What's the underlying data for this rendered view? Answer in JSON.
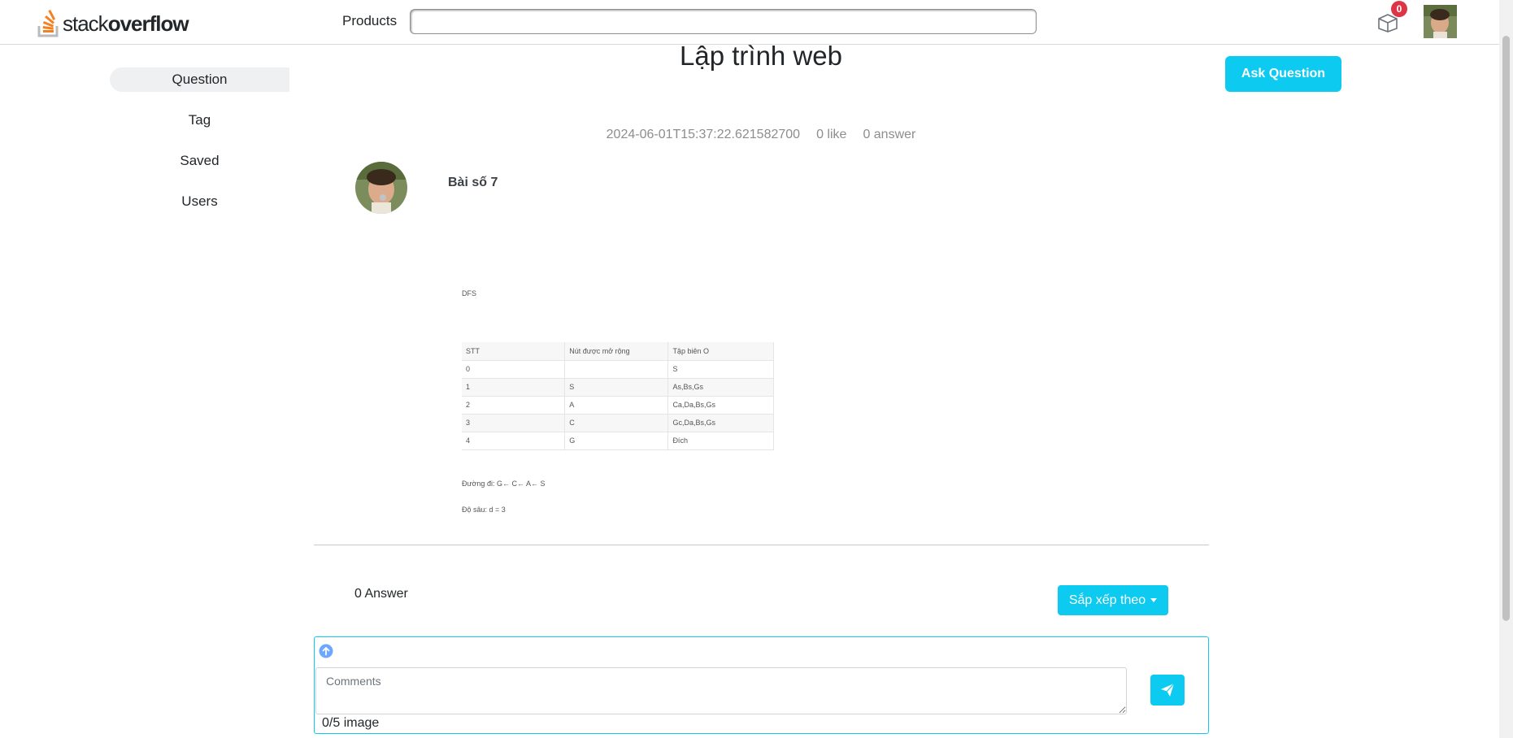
{
  "header": {
    "logo_text_light": "stack",
    "logo_text_bold": "overflow",
    "products_label": "Products",
    "search_placeholder": "",
    "inbox_badge": "0"
  },
  "sidebar": {
    "items": [
      {
        "label": "Question",
        "active": true
      },
      {
        "label": "Tag"
      },
      {
        "label": "Saved"
      },
      {
        "label": "Users"
      }
    ]
  },
  "question": {
    "title": "Lập trình web",
    "ask_button": "Ask Question",
    "timestamp": "2024-06-01T15:37:22.621582700",
    "likes": "0 like",
    "answers": "0 answer",
    "heading": "Bài số 7"
  },
  "post_image": {
    "label_top": "DFS",
    "table_header": [
      "STT",
      "Nút được mở rộng",
      "Tập biên O"
    ],
    "table_rows": [
      [
        "0",
        "",
        "S"
      ],
      [
        "1",
        "S",
        "As,Bs,Gs"
      ],
      [
        "2",
        "A",
        "Ca,Da,Bs,Gs"
      ],
      [
        "3",
        "C",
        "Gc,Da,Bs,Gs"
      ],
      [
        "4",
        "G",
        "Đích"
      ]
    ],
    "path_line": "Đường đi: G← C← A← S",
    "depth_line": "Độ sâu: d = 3"
  },
  "answers_section": {
    "count_label": "0 Answer",
    "sort_label": "Sắp xếp theo"
  },
  "comment": {
    "placeholder": "Comments",
    "image_count": "0/5 image"
  },
  "colors": {
    "accent": "#0dcaf0",
    "badge": "#dc3545",
    "logo_orange": "#f48024"
  }
}
